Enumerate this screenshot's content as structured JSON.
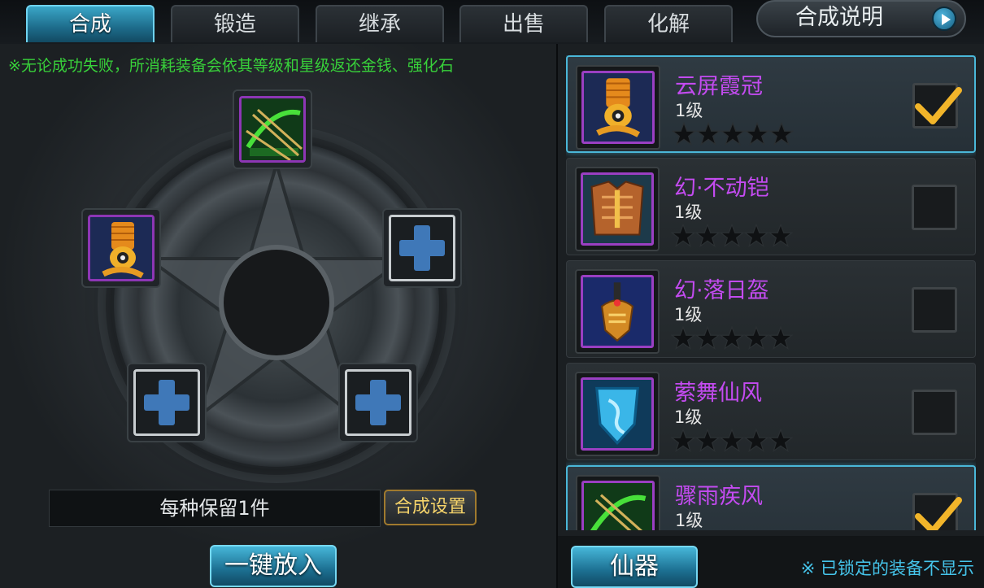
{
  "tabs": [
    {
      "label": "合成",
      "active": true
    },
    {
      "label": "锻造",
      "active": false
    },
    {
      "label": "继承",
      "active": false
    },
    {
      "label": "出售",
      "active": false
    },
    {
      "label": "化解",
      "active": false
    }
  ],
  "help": {
    "label": "合成说明",
    "icon": "play-arrow-icon"
  },
  "notice": "※无论成功失败，所消耗装备会依其等级和星级返还金钱、强化石",
  "slots": [
    {
      "position": "top",
      "filled": true,
      "icon": "bow-icon"
    },
    {
      "position": "left",
      "filled": true,
      "icon": "crown-icon"
    },
    {
      "position": "right",
      "filled": false,
      "icon": "plus-icon"
    },
    {
      "position": "bottom-left",
      "filled": false,
      "icon": "plus-icon"
    },
    {
      "position": "bottom-right",
      "filled": false,
      "icon": "plus-icon"
    }
  ],
  "keep_text": "每种保留1件",
  "settings_label": "合成设置",
  "put_all_label": "一键放入",
  "items": [
    {
      "name": "云屏霞冠",
      "level": "1级",
      "stars": 0,
      "max_stars": 5,
      "checked": true,
      "selected": true,
      "icon": "crown-icon"
    },
    {
      "name": "幻·不动铠",
      "level": "1级",
      "stars": 0,
      "max_stars": 5,
      "checked": false,
      "selected": false,
      "icon": "armor-icon"
    },
    {
      "name": "幻·落日盔",
      "level": "1级",
      "stars": 0,
      "max_stars": 5,
      "checked": false,
      "selected": false,
      "icon": "helmet-icon"
    },
    {
      "name": "萦舞仙风",
      "level": "1级",
      "stars": 0,
      "max_stars": 5,
      "checked": false,
      "selected": false,
      "icon": "shield-icon"
    },
    {
      "name": "骤雨疾风",
      "level": "1级",
      "stars": 0,
      "max_stars": 5,
      "checked": true,
      "selected": true,
      "icon": "bow-icon"
    }
  ],
  "category_label": "仙器",
  "locked_note": "※ 已锁定的装备不显示",
  "colors": {
    "accent": "#3aa6c7",
    "item_name": "#c34bf0",
    "notice": "#38d13a",
    "note": "#45c4ea",
    "frame": "#9a3fc2"
  }
}
